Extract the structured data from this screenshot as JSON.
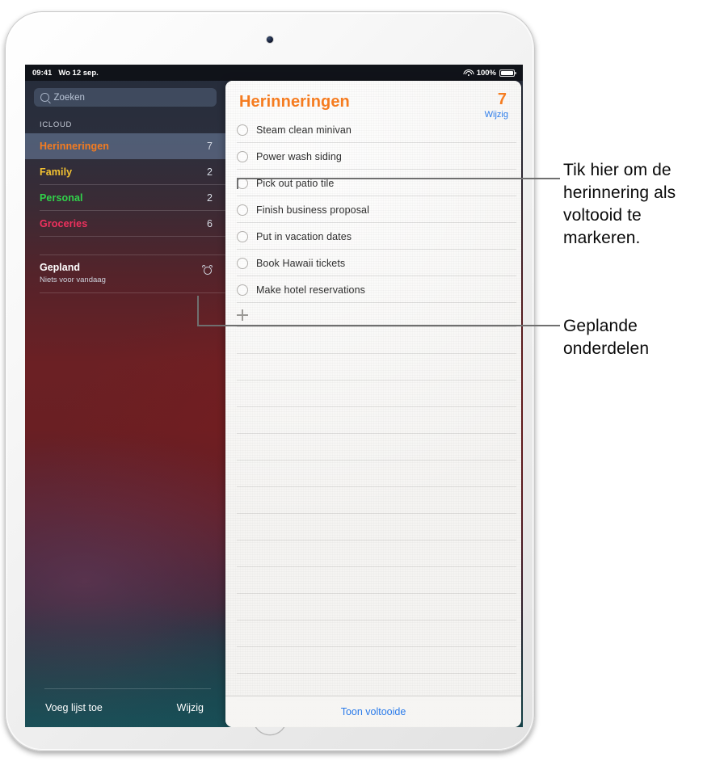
{
  "status_bar": {
    "time": "09:41",
    "date": "Wo 12 sep.",
    "wifi_icon": "wifi-icon",
    "battery_percent": "100%",
    "battery_icon": "battery-full-icon"
  },
  "sidebar": {
    "search": {
      "placeholder": "Zoeken",
      "value": "",
      "icon": "search-icon"
    },
    "section_header": "ICLOUD",
    "lists": [
      {
        "name": "Herinneringen",
        "count": "7",
        "color": "#f57c20",
        "selected": true
      },
      {
        "name": "Family",
        "count": "2",
        "color": "#f2c131",
        "selected": false
      },
      {
        "name": "Personal",
        "count": "2",
        "color": "#31d24a",
        "selected": false
      },
      {
        "name": "Groceries",
        "count": "6",
        "color": "#f0315e",
        "selected": false
      }
    ],
    "scheduled": {
      "title": "Gepland",
      "subtitle": "Niets voor vandaag",
      "icon": "alarm-clock-icon"
    },
    "toolbar": {
      "add_list": "Voeg lijst toe",
      "edit": "Wijzig"
    }
  },
  "panel": {
    "title": "Herinneringen",
    "count": "7",
    "edit_label": "Wijzig",
    "reminders": [
      {
        "text": "Steam clean minivan",
        "completed": false
      },
      {
        "text": "Power wash siding",
        "completed": false
      },
      {
        "text": "Pick out patio tile",
        "completed": false
      },
      {
        "text": "Finish business proposal",
        "completed": false
      },
      {
        "text": "Put in vacation dates",
        "completed": false
      },
      {
        "text": "Book Hawaii tickets",
        "completed": false
      },
      {
        "text": "Make hotel reservations",
        "completed": false
      }
    ],
    "add_icon": "plus-icon",
    "show_completed": "Toon voltooide"
  },
  "callouts": [
    {
      "text": "Tik hier om de herinnering als voltooid te markeren."
    },
    {
      "text": "Geplande onderdelen"
    }
  ],
  "colors": {
    "accent_orange": "#f57c20",
    "link_blue": "#2a7bea",
    "leader_gray": "#6f6f6f"
  }
}
